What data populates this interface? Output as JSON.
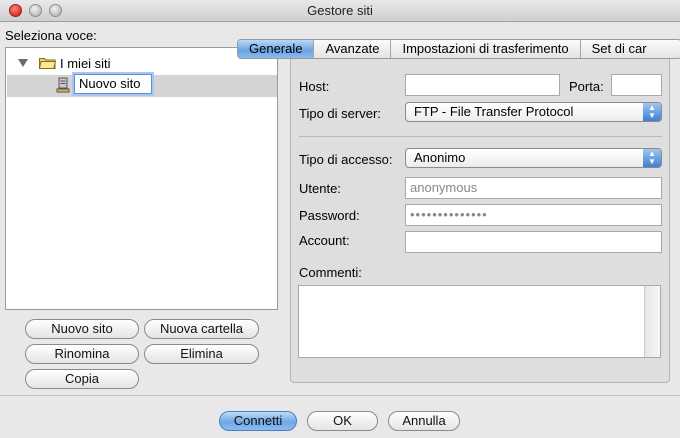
{
  "window": {
    "title": "Gestore siti"
  },
  "left": {
    "select_label": "Seleziona voce:",
    "tree": {
      "root_label": "I miei siti",
      "child_label": "Nuovo sito"
    },
    "buttons": {
      "new_site": "Nuovo sito",
      "new_folder": "Nuova cartella",
      "rename": "Rinomina",
      "delete": "Elimina",
      "copy": "Copia"
    }
  },
  "tabs": [
    "Generale",
    "Avanzate",
    "Impostazioni di trasferimento",
    "Set di car"
  ],
  "form": {
    "host_label": "Host:",
    "host_value": "",
    "port_label": "Porta:",
    "port_value": "",
    "server_type_label": "Tipo di server:",
    "server_type_value": "FTP - File Transfer Protocol",
    "access_type_label": "Tipo di accesso:",
    "access_type_value": "Anonimo",
    "user_label": "Utente:",
    "user_value": "anonymous",
    "password_label": "Password:",
    "password_value": "••••••••••••••",
    "account_label": "Account:",
    "account_value": "",
    "comments_label": "Commenti:"
  },
  "footer": {
    "connect": "Connetti",
    "ok": "OK",
    "cancel": "Annulla"
  },
  "colors": {
    "accent": "#6fa8e6",
    "close_button": "#d8302a",
    "selection": "#d4d4d4"
  }
}
